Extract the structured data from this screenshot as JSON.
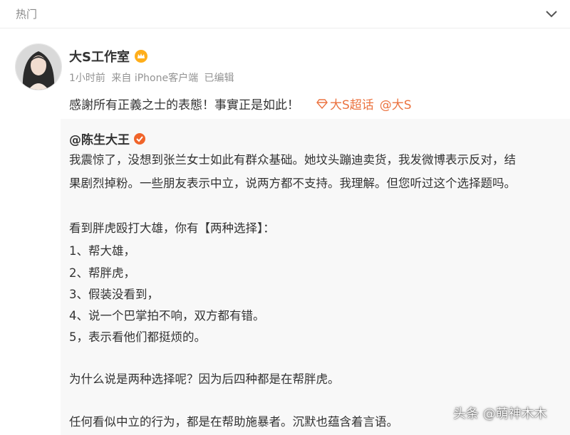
{
  "header": {
    "title": "热门"
  },
  "post": {
    "author": "大S工作室",
    "meta": {
      "time": "1小时前",
      "source": "来自 iPhone客户端",
      "edited": "已编辑"
    },
    "text": "感謝所有正義之士的表態！事實正是如此！",
    "topic": "大S超话",
    "mention": "@大S"
  },
  "repost": {
    "author": "@陈生大王",
    "lines": [
      "我震惊了，没想到张兰女士如此有群众基础。她坟头蹦迪卖货，我发微博表示反对，结",
      "果剧烈掉粉。一些朋友表示中立，说两方都不支持。我理解。但您听过这个选择题吗。",
      "看到胖虎殴打大雄，你有【两种选择】：",
      "1、帮大雄，",
      "2、帮胖虎，",
      "3、假装没看到，",
      "4、说一个巴掌拍不响，双方都有错。",
      "5，表示看他们都挺烦的。",
      "为什么说是两种选择呢？因为后四种都是在帮胖虎。",
      "任何看似中立的行为，都是在帮助施暴者。沉默也蕴含着言语。"
    ]
  },
  "watermark": "头条 @萌神木木",
  "colors": {
    "link": "#eb7340",
    "repost_bg": "#f8f8f8",
    "meta": "#939393"
  }
}
